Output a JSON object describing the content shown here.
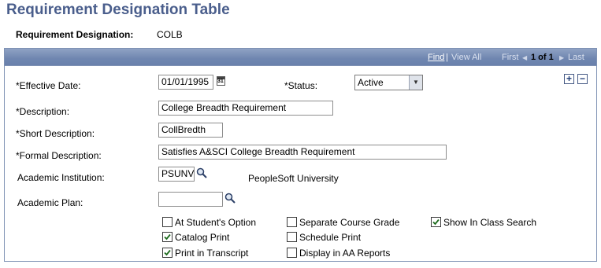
{
  "page": {
    "title": "Requirement Designation Table"
  },
  "header": {
    "rd_label": "Requirement Designation:",
    "rd_value": "COLB"
  },
  "nav": {
    "find": "Find",
    "sep": "|",
    "view_all": "View All",
    "first": "First",
    "range": "1 of 1",
    "last": "Last"
  },
  "form": {
    "effective_date": {
      "label": "*Effective Date:",
      "value": "01/01/1995"
    },
    "status": {
      "label": "*Status:",
      "value": "Active"
    },
    "description": {
      "label": "*Description:",
      "value": "College Breadth Requirement"
    },
    "short_description": {
      "label": "*Short Description:",
      "value": "CollBredth"
    },
    "formal_description": {
      "label": "*Formal Description:",
      "value": "Satisfies A&SCI College Breadth Requirement"
    },
    "academic_institution": {
      "label": "Academic Institution:",
      "value": "PSUNV",
      "descr": "PeopleSoft University"
    },
    "academic_plan": {
      "label": "Academic Plan:",
      "value": ""
    }
  },
  "checkboxes": [
    {
      "label": "At Student's Option",
      "checked": false
    },
    {
      "label": "Separate Course Grade",
      "checked": false
    },
    {
      "label": "Show In Class Search",
      "checked": true
    },
    {
      "label": "Catalog Print",
      "checked": true
    },
    {
      "label": "Schedule Print",
      "checked": false
    },
    {
      "label": "Print in Transcript",
      "checked": true
    },
    {
      "label": "Display in AA Reports",
      "checked": false
    }
  ],
  "icons": {
    "add": "plus-icon",
    "delete": "minus-icon",
    "lookup": "magnifier-icon",
    "calendar": "calendar-icon"
  }
}
